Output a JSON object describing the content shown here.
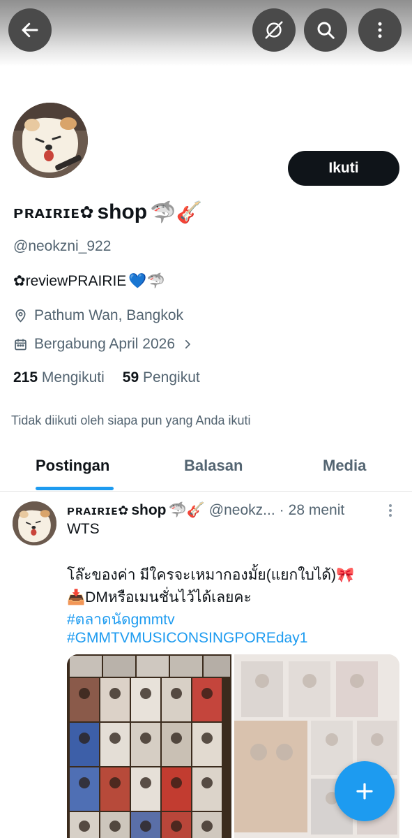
{
  "header": {
    "back_icon": "arrow-left-icon",
    "hide_icon": "eye-slash-icon",
    "search_icon": "search-icon",
    "more_icon": "more-vertical-icon"
  },
  "profile": {
    "follow_label": "Ikuti",
    "name_brand": "ᴘʀᴀɪʀɪᴇ✿",
    "name_text": "shop",
    "name_emoji": "🦈🎸",
    "handle": "@neokzni_922",
    "bio_text": "✿reviewPRAIRIE",
    "bio_emoji": "💙🦈",
    "location": "Pathum Wan, Bangkok",
    "joined": "Bergabung April 2026",
    "following_count": "215",
    "following_label": "Mengikuti",
    "followers_count": "59",
    "followers_label": "Pengikut",
    "followed_by_note": "Tidak diikuti oleh siapa pun yang Anda ikuti"
  },
  "tabs": [
    {
      "label": "Postingan"
    },
    {
      "label": "Balasan"
    },
    {
      "label": "Media"
    }
  ],
  "post": {
    "author_brand": "ᴘʀᴀɪʀɪᴇ✿",
    "author_name": "shop",
    "author_emoji": "🦈🎸",
    "handle": "@neokz...",
    "separator": "·",
    "time": "28 menit",
    "line1": "WTS",
    "line2": "โล๊ะของค่า มีใครจะเหมาก​องมั้ย(แยกใบได้)🎀",
    "line3": "📥DMหรือเมนชั่นไว้ได้เลยคะ",
    "hashtag1": "#ตลาดนัดgmmtv",
    "hashtag2": "#GMMTVMUSICONSINGPOREday1"
  },
  "fab": {
    "icon": "plus-icon"
  },
  "colors": {
    "accent": "#1d9bf0",
    "text": "#0f1419",
    "secondary": "#536471"
  }
}
